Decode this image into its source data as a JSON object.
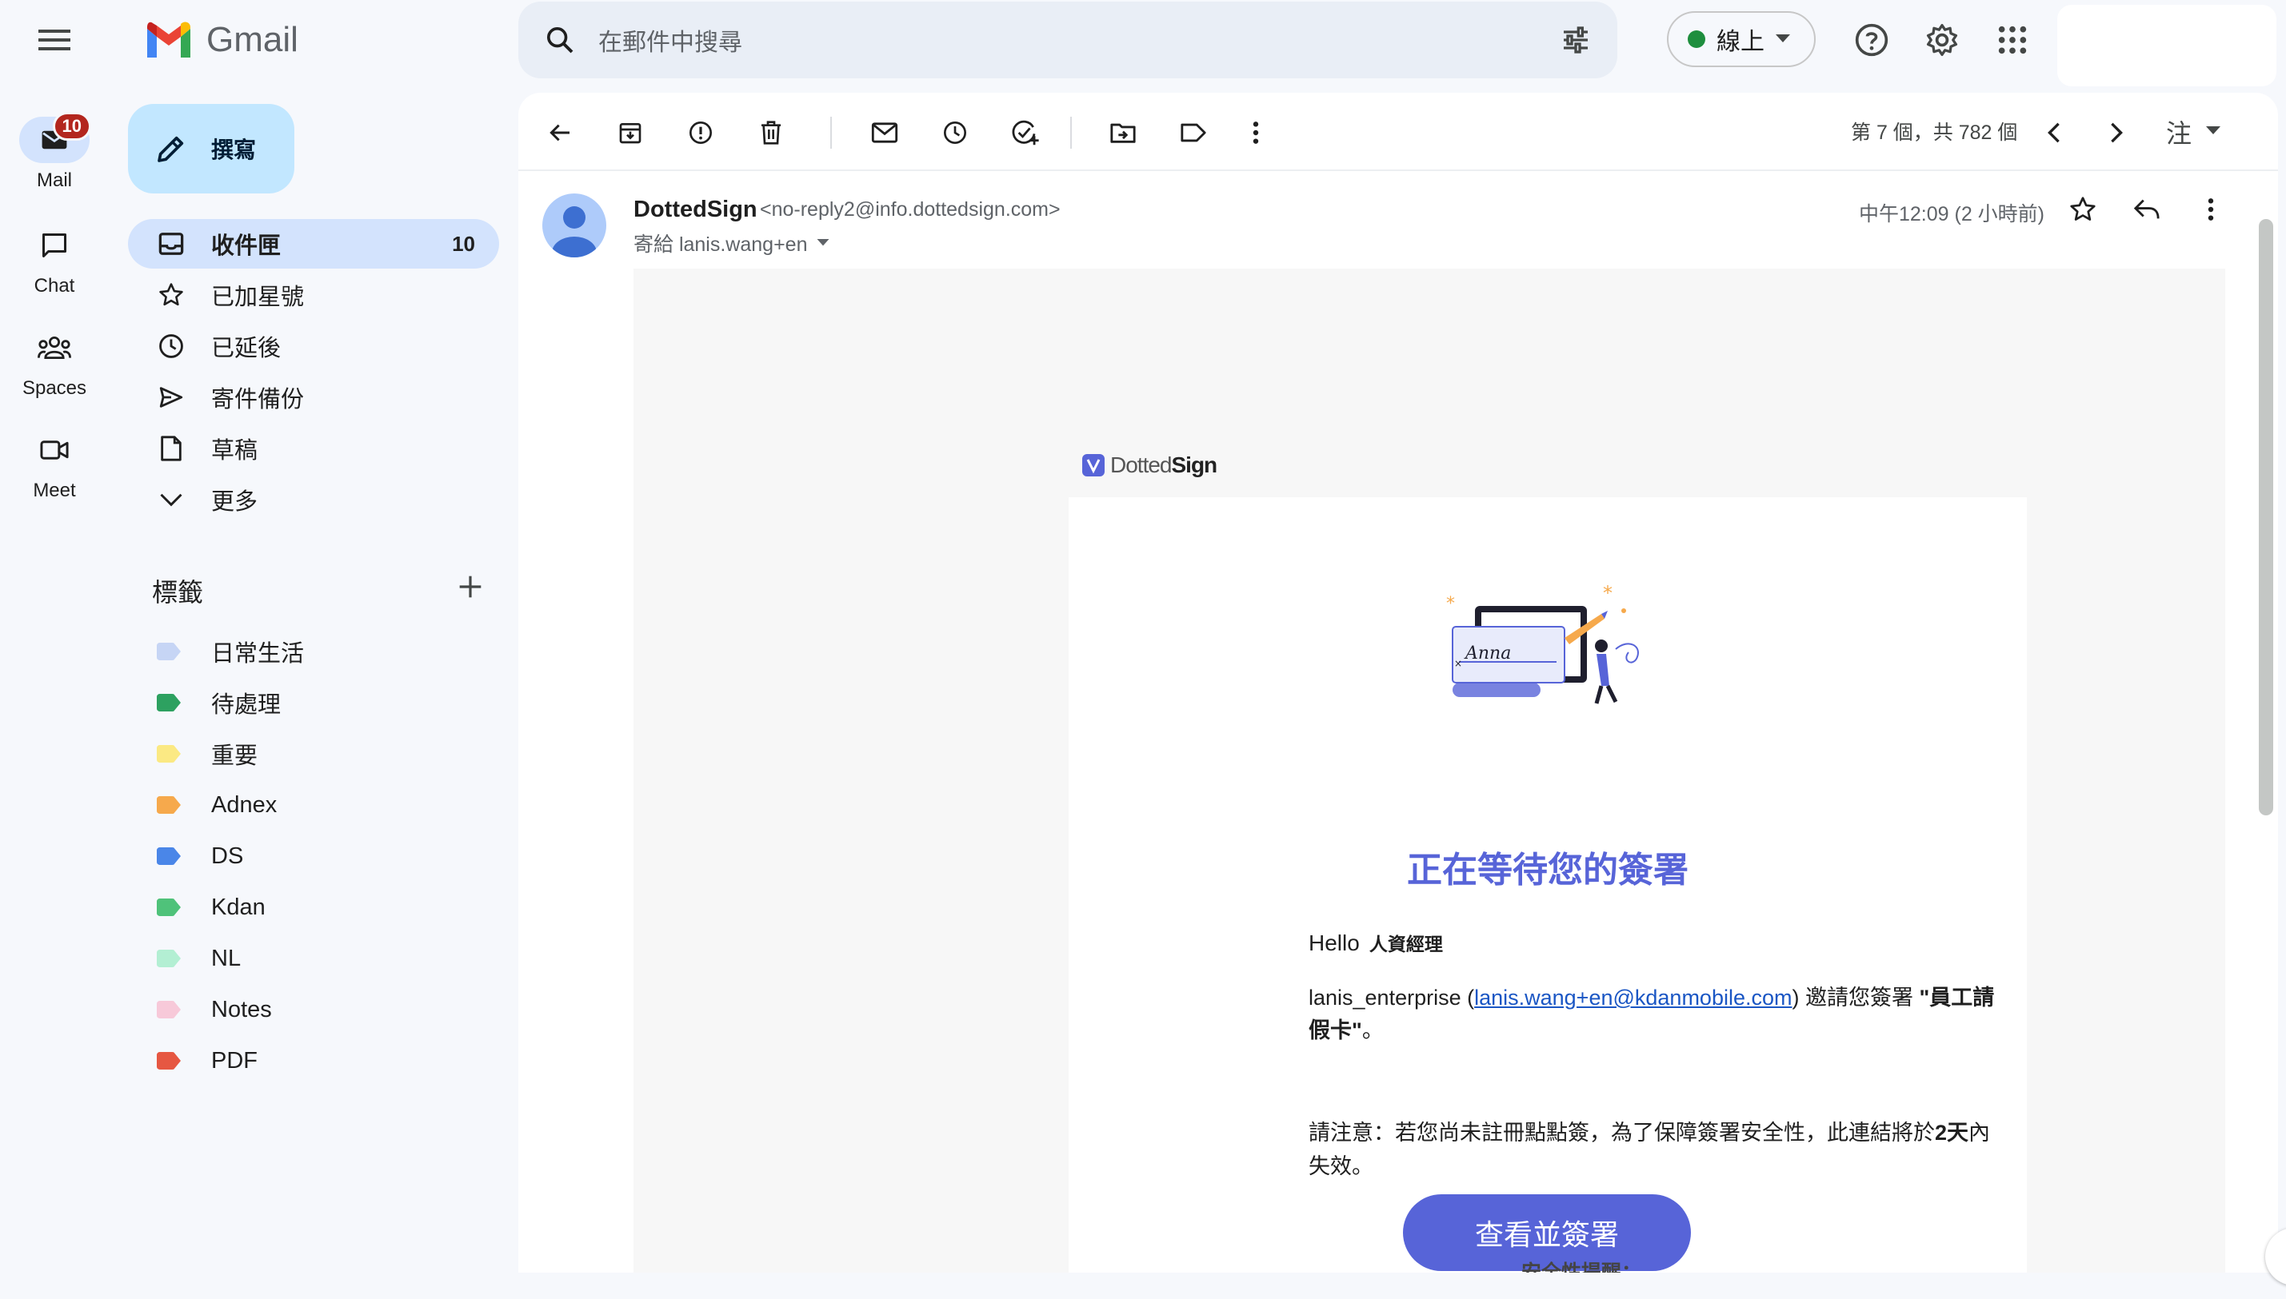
{
  "app": {
    "name": "Gmail"
  },
  "search": {
    "placeholder": "在郵件中搜尋"
  },
  "status": {
    "label": "線上",
    "color": "#1e8e3e"
  },
  "rail": {
    "mail": {
      "label": "Mail",
      "badge": "10"
    },
    "chat": {
      "label": "Chat"
    },
    "spaces": {
      "label": "Spaces"
    },
    "meet": {
      "label": "Meet"
    }
  },
  "compose": {
    "label": "撰寫"
  },
  "nav": [
    {
      "label": "收件匣",
      "count": "10",
      "icon": "inbox-icon"
    },
    {
      "label": "已加星號",
      "icon": "star-icon"
    },
    {
      "label": "已延後",
      "icon": "clock-icon"
    },
    {
      "label": "寄件備份",
      "icon": "send-icon"
    },
    {
      "label": "草稿",
      "icon": "draft-icon"
    },
    {
      "label": "更多",
      "icon": "chevron-down-icon"
    }
  ],
  "labels": {
    "heading": "標籤",
    "items": [
      {
        "name": "日常生活",
        "color": "#c6d5f5"
      },
      {
        "name": "待處理",
        "color": "#2da160"
      },
      {
        "name": "重要",
        "color": "#fbe983"
      },
      {
        "name": "Adnex",
        "color": "#f6a94c"
      },
      {
        "name": "DS",
        "color": "#4a86e8"
      },
      {
        "name": "Kdan",
        "color": "#4fc27a"
      },
      {
        "name": "NL",
        "color": "#b3efd3"
      },
      {
        "name": "Notes",
        "color": "#f7c9d9"
      },
      {
        "name": "PDF",
        "color": "#e65742"
      }
    ]
  },
  "toolbar": {
    "pager": "第 7 個，共 782 個",
    "lang": "注"
  },
  "message": {
    "sender_name": "DottedSign",
    "sender_email": "<no-reply2@info.dottedsign.com>",
    "to": "寄給 lanis.wang+en",
    "time": "中午12:09 (2 小時前)"
  },
  "email": {
    "brand_light": "Dotted",
    "brand_bold": "Sign",
    "title": "正在等待您的簽署",
    "greeting": "Hello",
    "recipient_role": "人資經理",
    "invite_prefix": "lanis_enterprise (",
    "invite_email": "lanis.wang+en@kdanmobile.com",
    "invite_mid": ") 邀請您簽署 ",
    "invite_doc": "\"員工請假卡\"",
    "invite_suffix": "。",
    "notice_prefix": "請注意：若您尚未註冊點點簽，為了保障簽署安全性，此連結將於",
    "notice_days": "2天",
    "notice_suffix": "內失效。",
    "cta": "查看並簽署",
    "security": "安全性提醒："
  },
  "colors": {
    "accent": "#5764d8",
    "nav_active": "#d3e3fd",
    "compose": "#c2e7ff"
  }
}
